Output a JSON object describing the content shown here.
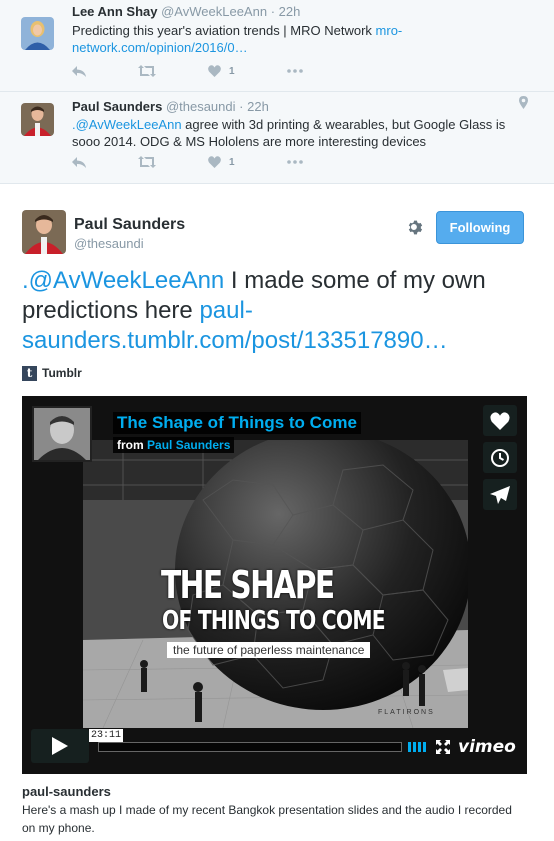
{
  "tweets": [
    {
      "fullname": "Lee Ann Shay",
      "username": "@AvWeekLeeAnn",
      "time": "22h",
      "text": "Predicting this year's aviation trends | MRO Network ",
      "link": "mro-network.com/opinion/2016/0…",
      "likes": "1"
    },
    {
      "fullname": "Paul Saunders",
      "username": "@thesaundi",
      "time": "22h",
      "mention": ".@AvWeekLeeAnn",
      "text": " agree with 3d printing & wearables, but Google Glass is sooo 2014. ODG & MS Hololens are more interesting devices",
      "likes": "1"
    }
  ],
  "main_tweet": {
    "fullname": "Paul Saunders",
    "username": "@thesaundi",
    "follow_label": "Following",
    "mention": ".@AvWeekLeeAnn",
    "text": " I made some of my own predictions here ",
    "link": "paul-saunders.tumblr.com/post/133517890…",
    "source_label": "Tumblr"
  },
  "video": {
    "title": "The Shape of Things to Come",
    "from_label": "from",
    "author": "Paul Saunders",
    "slide_title_1": "THE SHAPE",
    "slide_title_2": "OF THINGS TO COME",
    "slide_subtitle": "the future of paperless maintenance",
    "slide_brand": "FLATIRONS",
    "time": "23:11",
    "progress": 0,
    "provider": "vimeo"
  },
  "card": {
    "title": "paul-saunders",
    "description": "Here's a mash up I made of my recent Bangkok presentation slides and the audio I recorded on my phone."
  },
  "colors": {
    "link": "#1b95e0",
    "follow_button": "#55acee",
    "vimeo_accent": "#00adef"
  }
}
